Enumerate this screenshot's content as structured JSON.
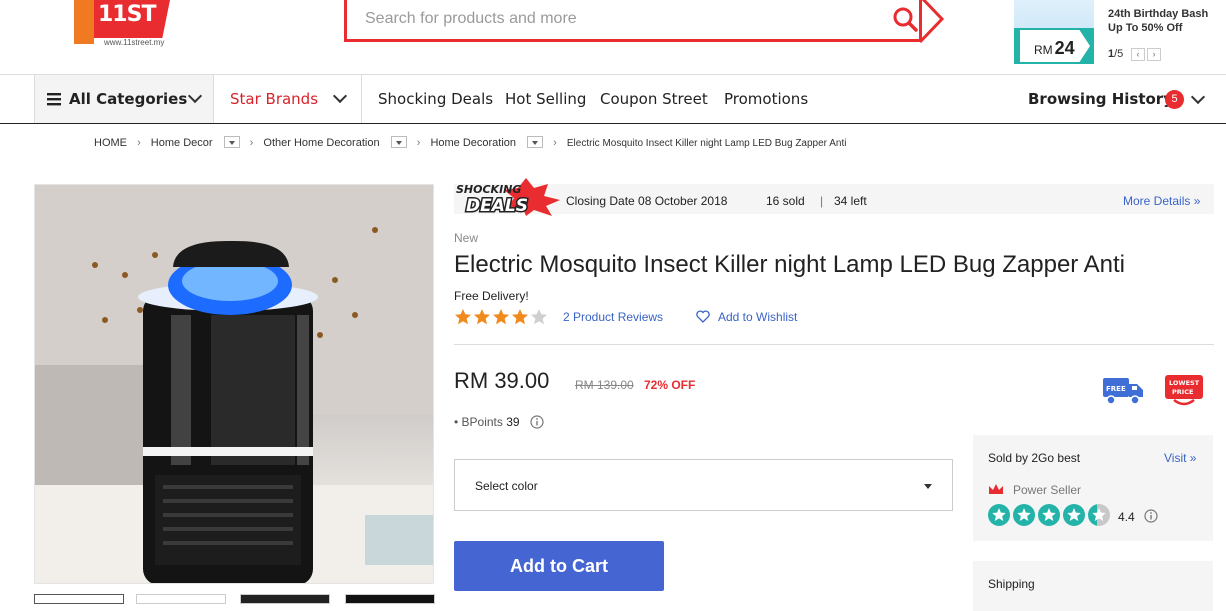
{
  "header": {
    "logo_text": "11ST",
    "logo_url": "www.11street.my",
    "search_placeholder": "Search for products and more",
    "promo": {
      "headline": "24th Birthday Bash",
      "subline": "Up To 50% Off",
      "price_prefix": "RM",
      "price_value": "24",
      "page_current": "1",
      "page_total": "/5",
      "prev_icon": "‹",
      "next_icon": "›"
    }
  },
  "nav": {
    "all_categories": "All Categories",
    "star_brands": "Star Brands",
    "links": [
      "Shocking Deals",
      "Hot Selling",
      "Coupon Street",
      "Promotions"
    ],
    "browsing_history": "Browsing History",
    "browsing_count": "5"
  },
  "breadcrumb": [
    "HOME",
    "Home Decor",
    "Other Home Decoration",
    "Home Decoration",
    "Electric Mosquito Insect Killer night Lamp LED Bug Zapper Anti"
  ],
  "deal": {
    "badge_line1": "SHOCKING",
    "badge_line2": "DEALS",
    "closing": "Closing Date 08 October 2018",
    "sold": "16 sold",
    "left": "34 left",
    "more": "More Details »"
  },
  "product": {
    "condition": "New",
    "title": "Electric Mosquito Insect Killer night Lamp LED Bug Zapper Anti",
    "free_delivery": "Free Delivery!",
    "rating_stars": 4,
    "reviews": "2 Product Reviews",
    "wishlist": "Add to Wishlist",
    "price": "RM 39.00",
    "old_price": "RM 139.00",
    "discount": "72% OFF",
    "free_badge": "FREE",
    "lowest_badge_1": "LOWEST",
    "lowest_badge_2": "PRICE",
    "bpoints_label": "• BPoints",
    "bpoints_value": "39",
    "select_color": "Select color",
    "add_to_cart": "Add to Cart"
  },
  "seller": {
    "sold_by": "Sold by",
    "name": "2Go best",
    "visit": "Visit »",
    "badge": "Power Seller",
    "rating": "4.4",
    "rating_value": 4.4
  },
  "shipping": {
    "label": "Shipping"
  },
  "colors": {
    "brand_red": "#e82c2f",
    "link_blue": "#3a63c8",
    "cart_blue": "#4565d2",
    "star_orange": "#f08a1c",
    "teal": "#23b3a8"
  }
}
